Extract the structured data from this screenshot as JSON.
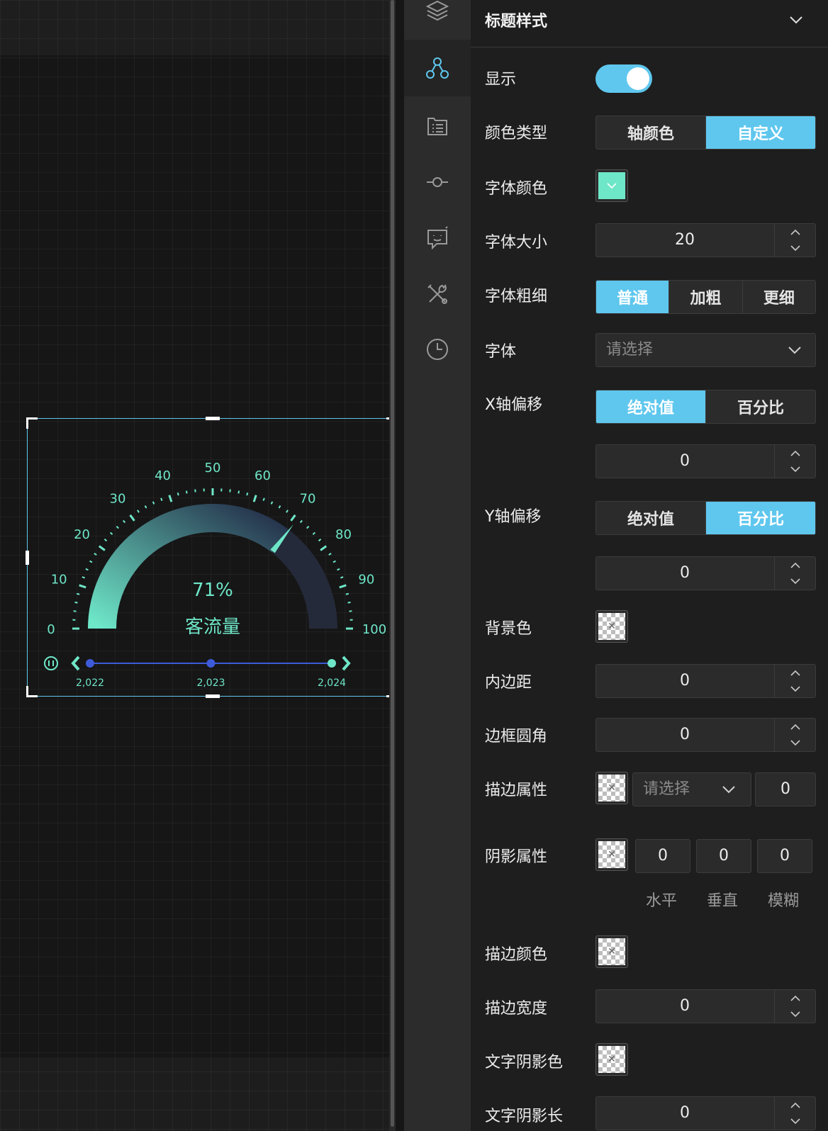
{
  "panel": {
    "title": "标题样式",
    "show": {
      "label": "显示",
      "on": true
    },
    "color_type": {
      "label": "颜色类型",
      "options": [
        "轴颜色",
        "自定义"
      ],
      "selected": 1
    },
    "font_color": {
      "label": "字体颜色",
      "color": "#6ee7c8"
    },
    "font_size": {
      "label": "字体大小",
      "value": "20"
    },
    "font_weight": {
      "label": "字体粗细",
      "options": [
        "普通",
        "加粗",
        "更细"
      ],
      "selected": 0
    },
    "font_family": {
      "label": "字体",
      "placeholder": "请选择"
    },
    "x_offset": {
      "label": "X轴偏移",
      "options": [
        "绝对值",
        "百分比"
      ],
      "selected": 0,
      "value": "0"
    },
    "y_offset": {
      "label": "Y轴偏移",
      "options": [
        "绝对值",
        "百分比"
      ],
      "selected": 1,
      "value": "0"
    },
    "bg_color": {
      "label": "背景色"
    },
    "padding": {
      "label": "内边距",
      "value": "0"
    },
    "border_radius": {
      "label": "边框圆角",
      "value": "0"
    },
    "border": {
      "label": "描边属性",
      "placeholder": "请选择",
      "value": "0"
    },
    "shadow": {
      "label": "阴影属性",
      "values": [
        "0",
        "0",
        "0"
      ],
      "captions": [
        "水平",
        "垂直",
        "模糊"
      ]
    },
    "stroke_color": {
      "label": "描边颜色"
    },
    "stroke_width": {
      "label": "描边宽度",
      "value": "0"
    },
    "text_shadow_color": {
      "label": "文字阴影色"
    },
    "text_shadow_length": {
      "label": "文字阴影长",
      "value": "0"
    }
  },
  "rail": {
    "icons": [
      "layers-icon",
      "nodes-icon",
      "list-icon",
      "commit-icon",
      "chat-bot-icon",
      "tools-icon",
      "clock-icon"
    ],
    "active": 1
  },
  "chart_data": {
    "type": "gauge",
    "min": 0,
    "max": 100,
    "value": 71,
    "value_label": "71%",
    "title": "客流量",
    "tick_labels": [
      "0",
      "10",
      "20",
      "30",
      "40",
      "50",
      "60",
      "70",
      "80",
      "90",
      "100"
    ],
    "colors": {
      "accent": "#6ee7c8",
      "track": "#252a3a",
      "timeline": "#3d5bd9"
    },
    "timeline": {
      "labels": [
        "2,022",
        "2,023",
        "2,024"
      ],
      "active": 2
    }
  }
}
